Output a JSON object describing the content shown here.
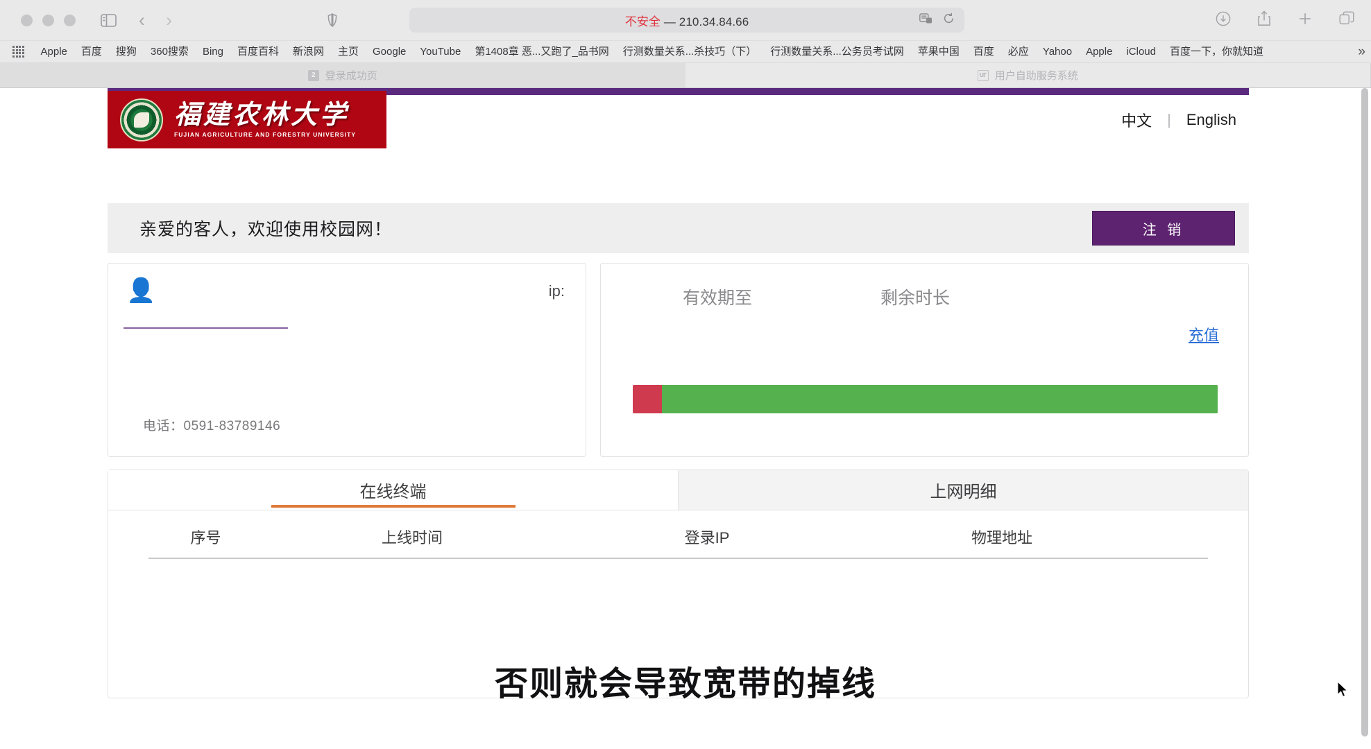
{
  "browser": {
    "url_warning": "不安全",
    "url_separator": "—",
    "url_host": "210.34.84.66",
    "icons": {
      "sidebar": "sidebar-icon",
      "back": "back-chevron-icon",
      "forward": "forward-chevron-icon",
      "shield": "privacy-shield-icon",
      "reader": "reader-view-icon",
      "reload": "reload-icon",
      "download": "download-icon",
      "share": "share-icon",
      "new_tab": "plus-icon",
      "tab_overview": "tab-overview-icon"
    },
    "bookmarks": [
      "Apple",
      "百度",
      "搜狗",
      "360搜索",
      "Bing",
      "百度百科",
      "新浪网",
      "主页",
      "Google",
      "YouTube",
      "第1408章 恶...又跑了_品书网",
      "行测数量关系...杀技巧（下）",
      "行测数量关系...公务员考试网",
      "苹果中国",
      "百度",
      "必应",
      "Yahoo",
      "Apple",
      "iCloud",
      "百度一下，你就知道"
    ],
    "bookmarks_overflow": "»",
    "tabs": [
      {
        "title": "登录成功页",
        "favicon_text": "2",
        "active": true
      },
      {
        "title": "用户自助服务系统",
        "favicon_text": "UΓ",
        "active": false
      }
    ]
  },
  "site": {
    "logo_cn": "福建农林大学",
    "logo_en": "FUJIAN AGRICULTURE AND FORESTRY UNIVERSITY",
    "lang_cn": "中文",
    "lang_divider": "|",
    "lang_en": "English",
    "accent_purple": "#5b2a7e",
    "logo_red": "#b00613"
  },
  "welcome": {
    "message": "亲爱的客人，欢迎使用校园网！",
    "logout_label": "注 销"
  },
  "user_card": {
    "avatar_icon": "user-avatar-icon",
    "ip_label": "ip:",
    "username_value": "",
    "phone": "电话：0591-83789146"
  },
  "balance_card": {
    "expiry_label": "有效期至",
    "remaining_label": "剩余时长",
    "expiry_value": "",
    "remaining_value": "",
    "recharge_label": "充值",
    "progress": {
      "used_percent": 5,
      "remaining_percent": 95,
      "used_color": "#d03a4f",
      "remaining_color": "#55b14d"
    }
  },
  "terminal_panel": {
    "tabs": [
      {
        "label": "在线终端",
        "active": true
      },
      {
        "label": "上网明细",
        "active": false
      }
    ],
    "active_tab_color": "#e07b39",
    "columns": [
      "序号",
      "上线时间",
      "登录IP",
      "物理地址"
    ],
    "rows": []
  },
  "subtitle": {
    "text": "否则就会导致宽带的掉线"
  }
}
